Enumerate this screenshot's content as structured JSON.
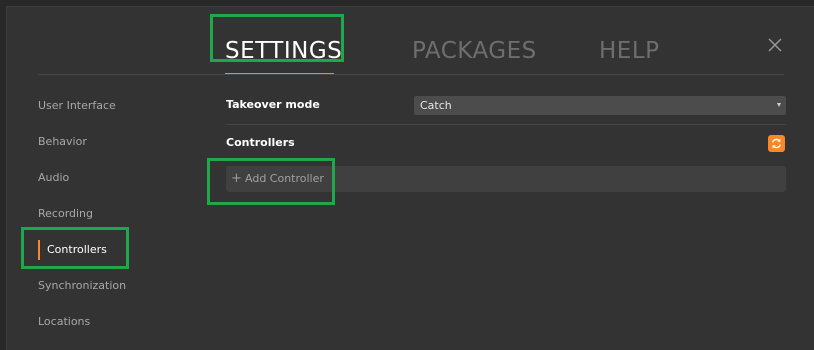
{
  "tabs": [
    {
      "label": "SETTINGS",
      "active": true
    },
    {
      "label": "PACKAGES",
      "active": false
    },
    {
      "label": "HELP",
      "active": false
    }
  ],
  "sidebar": {
    "items": [
      {
        "label": "User Interface",
        "active": false
      },
      {
        "label": "Behavior",
        "active": false
      },
      {
        "label": "Audio",
        "active": false
      },
      {
        "label": "Recording",
        "active": false
      },
      {
        "label": "Controllers",
        "active": true
      },
      {
        "label": "Synchronization",
        "active": false
      },
      {
        "label": "Locations",
        "active": false
      }
    ]
  },
  "content": {
    "takeover_label": "Takeover mode",
    "takeover_value": "Catch",
    "controllers_label": "Controllers",
    "add_controller_plus": "+",
    "add_controller_label": "Add Controller"
  },
  "icons": {
    "close": "close-icon",
    "refresh": "refresh-icon",
    "dropdown": "chevron-down-icon"
  },
  "colors": {
    "accent": "#f4882a",
    "highlight": "#1fa84a",
    "background": "#333333"
  }
}
